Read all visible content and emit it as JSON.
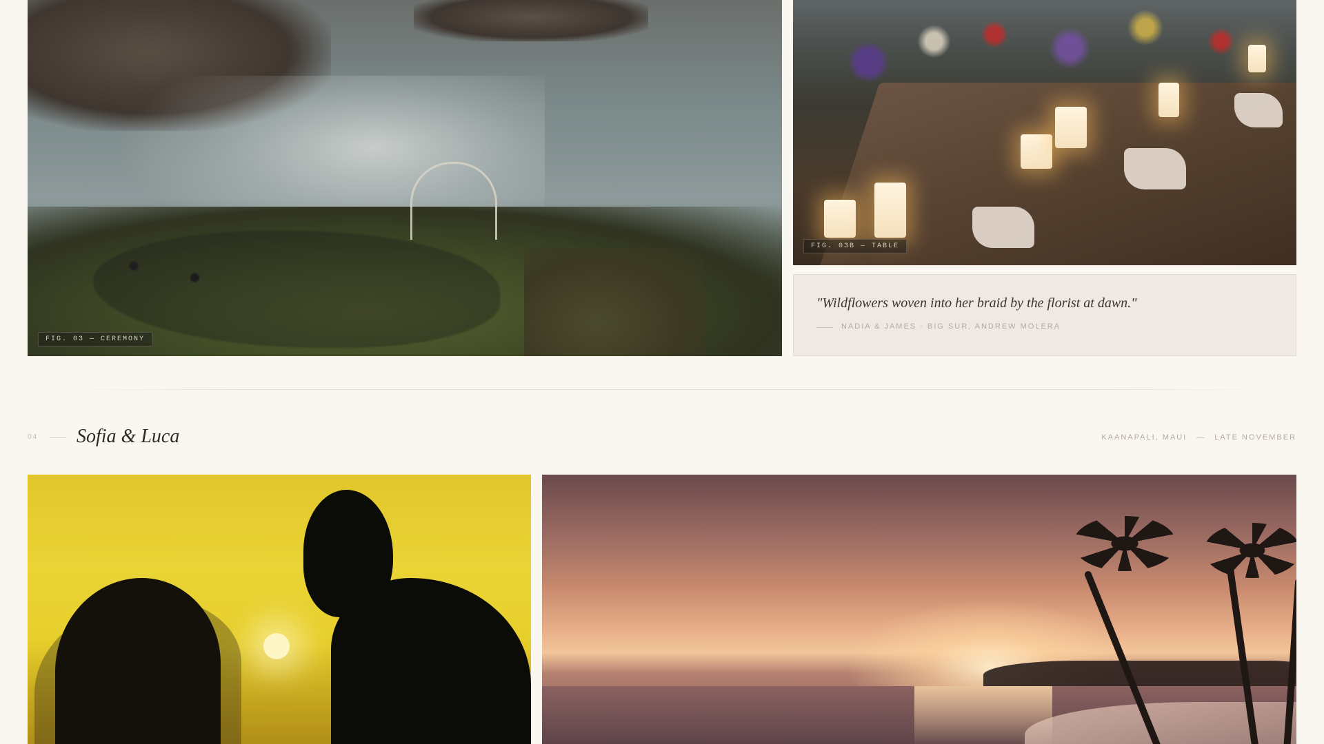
{
  "story_03": {
    "ceremony_photo": {
      "alt": "Cliffside wedding ceremony above the ocean",
      "fig_label": "FIG. 03 — CEREMONY"
    },
    "table_photo": {
      "alt": "Candlelit reception table with wildflowers",
      "fig_label": "FIG. 03B — TABLE"
    },
    "quote": {
      "text": "\"Wildflowers woven into her braid by the florist at dawn.\"",
      "attribution": "NADIA & JAMES · BIG SUR, ANDREW MOLERA"
    }
  },
  "story_04": {
    "index": "04",
    "title": "Sofia & Luca",
    "location": "KAANAPALI, MAUI",
    "season": "LATE NOVEMBER",
    "silhouette_photo": {
      "alt": "Silhouette of bride and groom at sunset"
    },
    "beach_photo": {
      "alt": "Sunset over a palm-lined beach"
    }
  }
}
